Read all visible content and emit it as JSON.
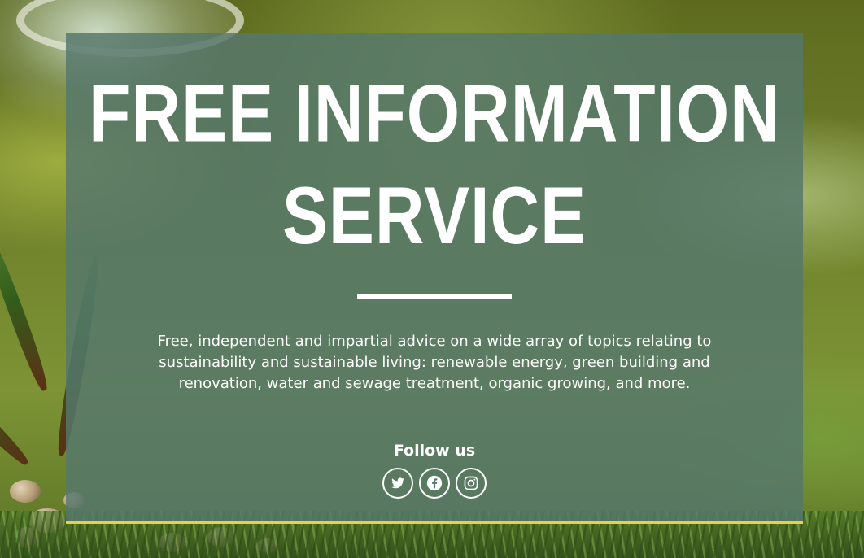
{
  "hero": {
    "title_line1": "FREE INFORMATION",
    "title_line2": "SERVICE",
    "description": "Free, independent and impartial advice on a wide array of topics relating to sustainability and sustainable living: renewable energy, green building and renovation, water and sewage treatment, organic growing, and more.",
    "follow_label": "Follow us"
  },
  "social": [
    {
      "icon": "twitter-icon"
    },
    {
      "icon": "facebook-icon"
    },
    {
      "icon": "instagram-icon"
    }
  ],
  "colors": {
    "overlay": "#56776c",
    "accent_bar": "#e9cf4e",
    "text": "#ffffff"
  }
}
